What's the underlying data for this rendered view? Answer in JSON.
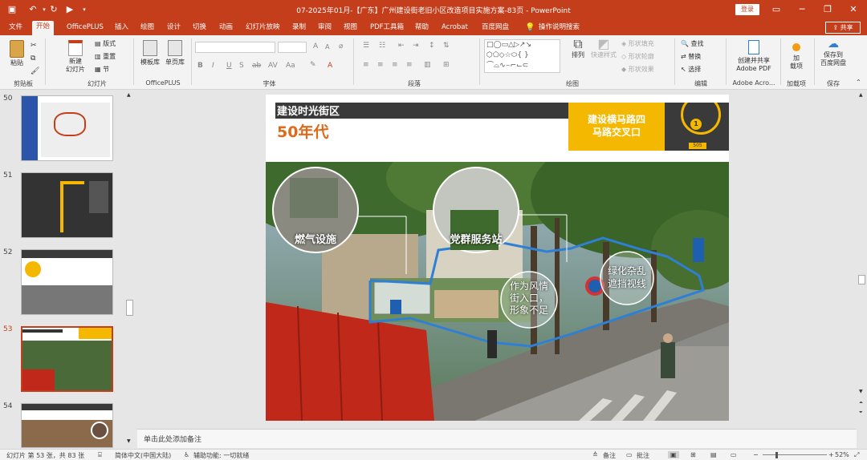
{
  "titlebar": {
    "title": "07-2025年01月-【广东】广州建设街老旧小区改造项目实施方案-83页 - PowerPoint",
    "login": "登录"
  },
  "tabs": [
    "文件",
    "开始",
    "OfficePLUS",
    "插入",
    "绘图",
    "设计",
    "切换",
    "动画",
    "幻灯片放映",
    "录制",
    "审阅",
    "视图",
    "PDF工具箱",
    "帮助",
    "Acrobat",
    "百度网盘",
    "操作说明搜索"
  ],
  "share_label": "共享",
  "ribbon": {
    "clipboard": {
      "paste": "粘贴",
      "label": "剪贴板"
    },
    "slides": {
      "new_slide": "新建\n幻灯片",
      "layout": "版式",
      "reset": "重置",
      "section": "节",
      "label": "幻灯片"
    },
    "officeplus": {
      "template": "模板库",
      "single": "单页库",
      "label": "OfficePLUS"
    },
    "font": {
      "label": "字体"
    },
    "paragraph": {
      "label": "段落"
    },
    "drawing": {
      "arrange": "排列",
      "quick_style": "快速样式",
      "fill": "形状填充",
      "outline": "形状轮廓",
      "effects": "形状效果",
      "label": "绘图"
    },
    "editing": {
      "find": "查找",
      "replace": "替换",
      "select": "选择",
      "label": "编辑"
    },
    "adobe": {
      "create": "创建并共享\nAdobe PDF",
      "label": "Adobe Acro..."
    },
    "addins": {
      "addin": "加\n载项",
      "label": "加载项"
    },
    "save": {
      "save": "保存到\n百度网盘",
      "label": "保存"
    }
  },
  "thumbnails": [
    {
      "num": "50",
      "current": false
    },
    {
      "num": "51",
      "current": false
    },
    {
      "num": "52",
      "current": false
    },
    {
      "num": "53",
      "current": true
    },
    {
      "num": "54",
      "current": false
    }
  ],
  "slide": {
    "header_title": "建设时光街区",
    "era": "50年代",
    "location_box": "建设横马路四\n马路交叉口",
    "map_number": "1",
    "map_code": "505",
    "callouts": {
      "gas": "燃气设施",
      "party": "党群服务站",
      "style": "作为风情\n街入口，\n形象不足",
      "green": "绿化杂乱\n遮挡视线"
    }
  },
  "notes_placeholder": "单击此处添加备注",
  "status": {
    "slide_info": "幻灯片 第 53 张，共 83 张",
    "language": "简体中文(中国大陆)",
    "accessibility": "辅助功能: 一切就绪",
    "notes": "备注",
    "comments": "批注",
    "zoom": "52%"
  },
  "colors": {
    "accent": "#c43e1c",
    "slide_yellow": "#f5b800",
    "slide_orange": "#e06a1a",
    "slide_dark": "#3a3a3a",
    "highlight_blue": "#2f7fd4"
  }
}
